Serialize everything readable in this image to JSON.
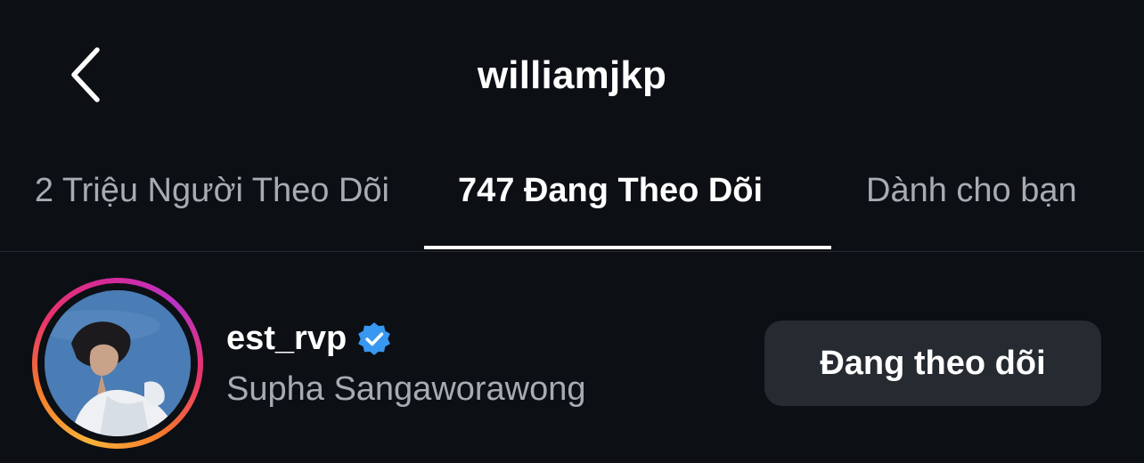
{
  "header": {
    "title": "williamjkp",
    "back_icon": "chevron-left-icon"
  },
  "tabs": [
    {
      "label": "2 Triệu Người Theo Dõi",
      "active": false
    },
    {
      "label": "747 Đang Theo Dõi",
      "active": true
    },
    {
      "label": "Dành cho bạn",
      "active": false
    }
  ],
  "list": [
    {
      "username": "est_rvp",
      "verified": true,
      "verified_icon": "verified-badge-icon",
      "full_name": "Supha Sangaworawong",
      "button_label": "Đang theo dõi",
      "story_ring": true
    }
  ],
  "colors": {
    "background": "#0c0f14",
    "text_primary": "#ffffff",
    "text_secondary": "#a8abb2",
    "button_bg": "#262a31",
    "verified_blue": "#3897f0"
  }
}
